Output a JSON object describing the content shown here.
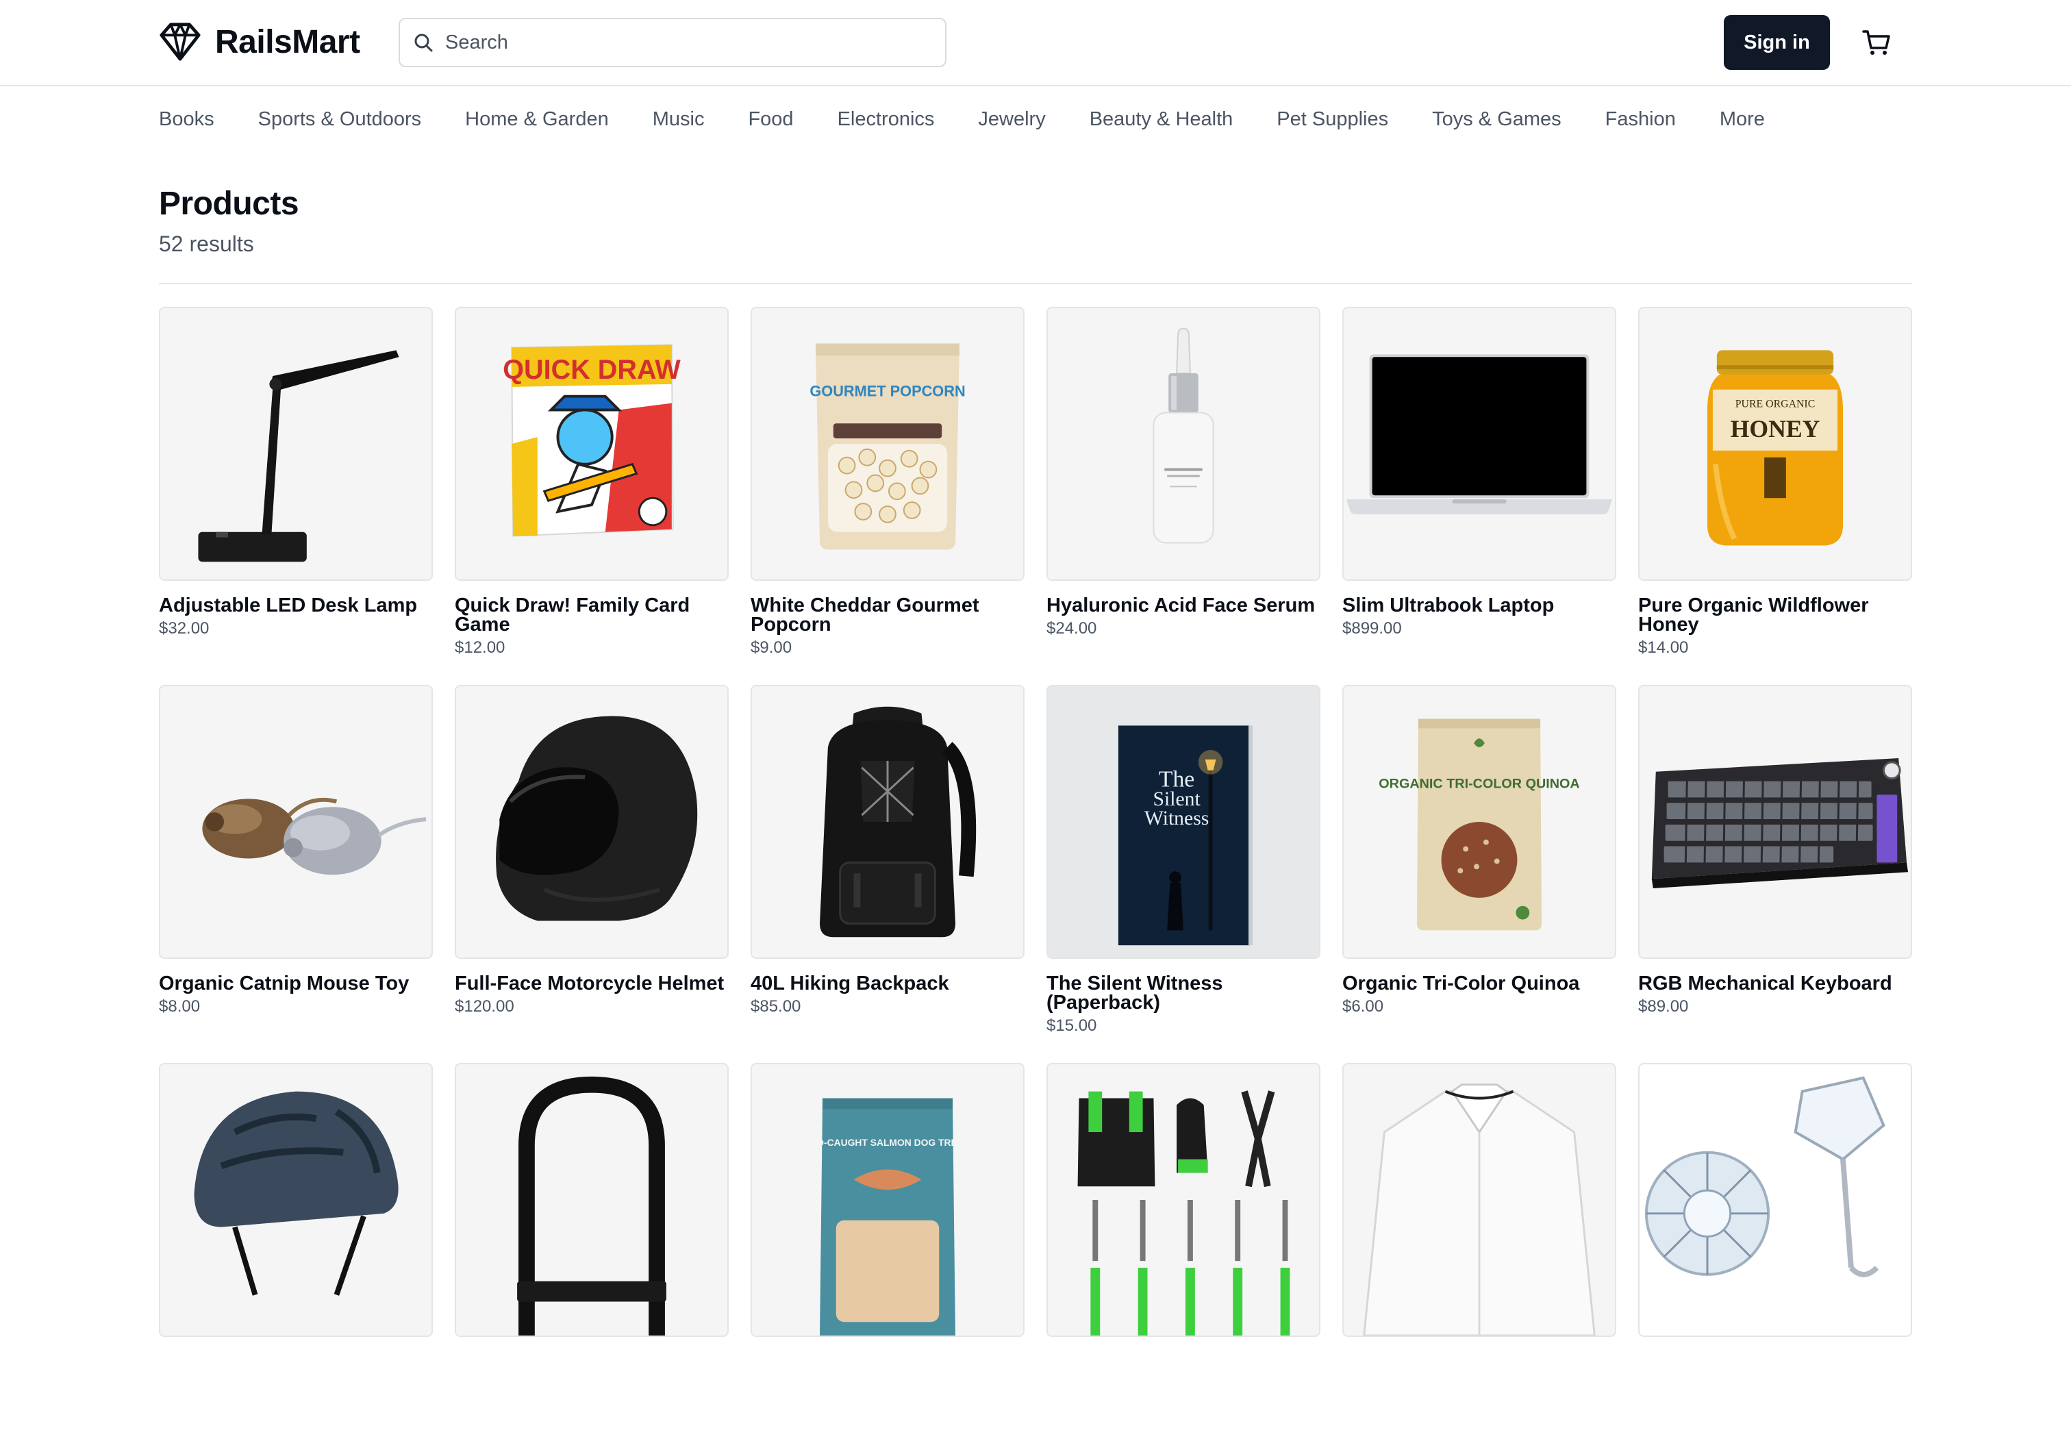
{
  "brand": {
    "name": "RailsMart"
  },
  "search": {
    "placeholder": "Search"
  },
  "header": {
    "signin_label": "Sign in"
  },
  "categories": [
    "Books",
    "Sports & Outdoors",
    "Home & Garden",
    "Music",
    "Food",
    "Electronics",
    "Jewelry",
    "Beauty & Health",
    "Pet Supplies",
    "Toys & Games",
    "Fashion",
    "More"
  ],
  "page": {
    "title": "Products",
    "count": "52 results"
  },
  "products": [
    {
      "name": "Adjustable LED Desk Lamp",
      "price": "$32.00",
      "image_icon": "desk-lamp"
    },
    {
      "name": "Quick Draw! Family Card Game",
      "price": "$12.00",
      "image_icon": "card-game-box",
      "image_text": "QUICK DRAW"
    },
    {
      "name": "White Cheddar Gourmet Popcorn",
      "price": "$9.00",
      "image_icon": "popcorn-bag",
      "image_text": "GOURMET POPCORN"
    },
    {
      "name": "Hyaluronic Acid Face Serum",
      "price": "$24.00",
      "image_icon": "serum-bottle"
    },
    {
      "name": "Slim Ultrabook Laptop",
      "price": "$899.00",
      "image_icon": "laptop"
    },
    {
      "name": "Pure Organic Wildflower Honey",
      "price": "$14.00",
      "image_icon": "honey-jar",
      "image_text": "HONEY"
    },
    {
      "name": "Organic Catnip Mouse Toy",
      "price": "$8.00",
      "image_icon": "mouse-toy"
    },
    {
      "name": "Full-Face Motorcycle Helmet",
      "price": "$120.00",
      "image_icon": "motorcycle-helmet"
    },
    {
      "name": "40L Hiking Backpack",
      "price": "$85.00",
      "image_icon": "backpack"
    },
    {
      "name": "The Silent Witness (Paperback)",
      "price": "$15.00",
      "image_icon": "book",
      "image_text": "The Silent Witness"
    },
    {
      "name": "Organic Tri-Color Quinoa",
      "price": "$6.00",
      "image_icon": "quinoa-bag",
      "image_text": "ORGANIC TRI-COLOR QUINOA"
    },
    {
      "name": "RGB Mechanical Keyboard",
      "price": "$89.00",
      "image_icon": "keyboard"
    },
    {
      "name": "",
      "price": "",
      "image_icon": "bike-helmet"
    },
    {
      "name": "",
      "price": "",
      "image_icon": "u-lock"
    },
    {
      "name": "",
      "price": "",
      "image_icon": "dog-treats-bag",
      "image_text": "WILD-CAUGHT SALMON DOG TREATS"
    },
    {
      "name": "",
      "price": "",
      "image_icon": "garden-tools"
    },
    {
      "name": "",
      "price": "",
      "image_icon": "dress-shirt"
    },
    {
      "name": "",
      "price": "",
      "image_icon": "diamond-earrings"
    }
  ],
  "colors": {
    "primary_button": "#111827",
    "muted_text": "#4b5563",
    "image_bg": "#f5f5f5"
  }
}
